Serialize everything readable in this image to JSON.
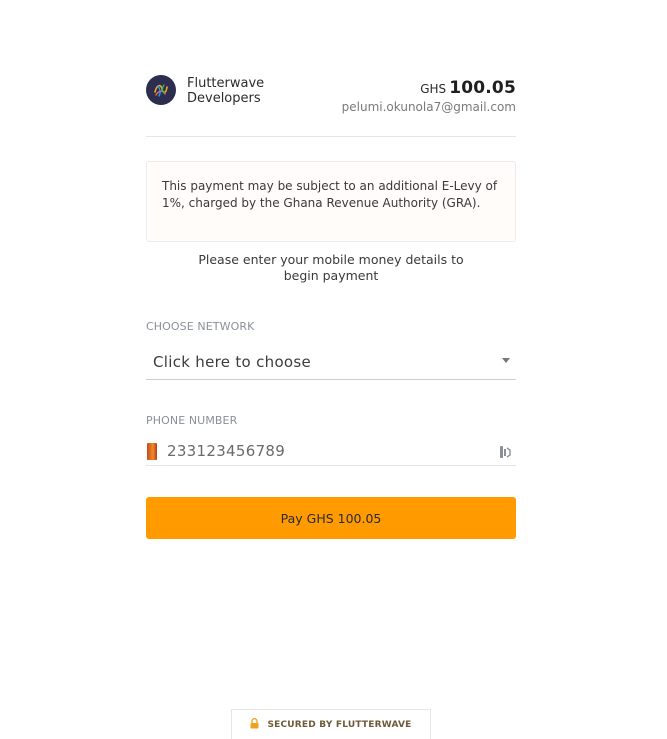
{
  "merchant": {
    "name_line1": "Flutterwave",
    "name_line2": "Developers",
    "logo_icon": "flutterwave-logo-icon"
  },
  "payment": {
    "currency": "GHS",
    "amount": "100.05",
    "email": "pelumi.okunola7@gmail.com"
  },
  "notice": {
    "text": "This payment may be subject to an additional E-Levy of 1%, charged by the Ghana Revenue Authority (GRA)."
  },
  "instruction": {
    "line1": "Please enter your mobile money details to",
    "line2": "begin payment"
  },
  "network": {
    "label": "CHOOSE NETWORK",
    "selected": "Click here to choose"
  },
  "phone": {
    "label": "PHONE NUMBER",
    "placeholder": "233123456789",
    "value": "",
    "country_flag_icon": "ghana-flag-icon"
  },
  "pay_button": {
    "label": "Pay GHS 100.05"
  },
  "footer": {
    "secured_text": "SECURED BY FLUTTERWAVE",
    "icon": "lock-icon"
  },
  "colors": {
    "accent": "#ff9b00",
    "logo_bg": "#2c2d4f",
    "notice_bg": "#fffcfa"
  }
}
